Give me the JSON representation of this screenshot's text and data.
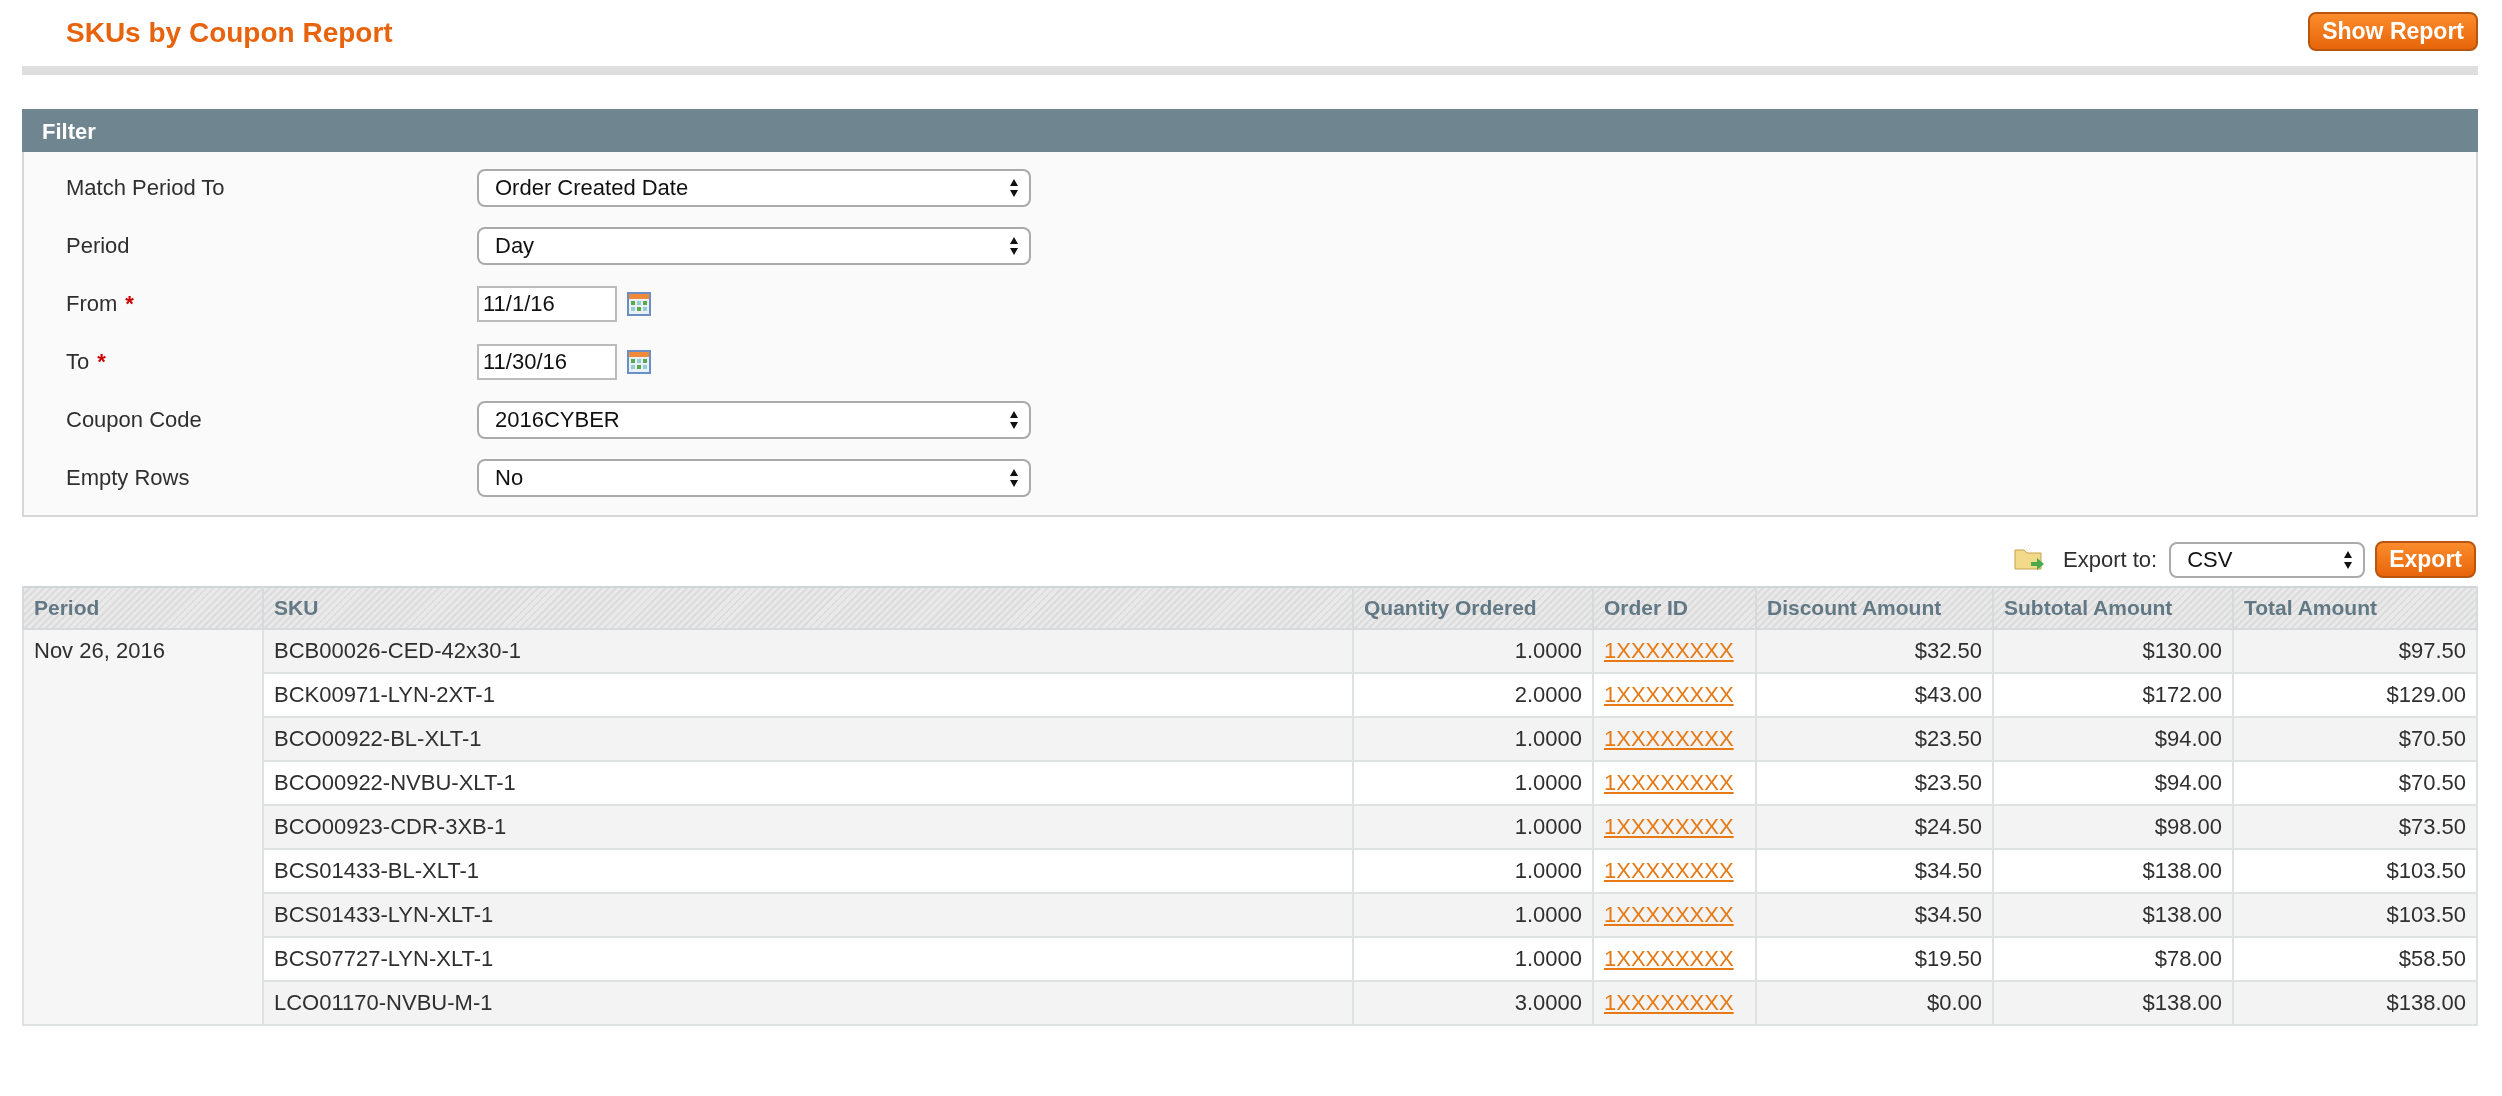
{
  "title": "SKUs by Coupon Report",
  "show_report_button": "Show Report",
  "filter": {
    "title": "Filter",
    "fields": [
      {
        "label": "Match Period To",
        "kind": "select",
        "value": "Order Created Date"
      },
      {
        "label": "Period",
        "kind": "select",
        "value": "Day"
      },
      {
        "label": "From",
        "required_mark": "*",
        "kind": "date",
        "value": "11/1/16"
      },
      {
        "label": "To",
        "required_mark": "*",
        "kind": "date",
        "value": "11/30/16"
      },
      {
        "label": "Coupon Code",
        "kind": "select",
        "value": "2016CYBER"
      },
      {
        "label": "Empty Rows",
        "kind": "select",
        "value": "No"
      }
    ]
  },
  "export": {
    "label": "Export to:",
    "format": "CSV",
    "button": "Export"
  },
  "table": {
    "columns": [
      "Period",
      "SKU",
      "Quantity Ordered",
      "Order ID",
      "Discount Amount",
      "Subtotal Amount",
      "Total Amount"
    ],
    "groups": [
      {
        "period": "Nov 26, 2016",
        "rows": [
          {
            "sku": "BCB00026-CED-42x30-1",
            "quantity": "1.0000",
            "order_id": "1XXXXXXXX",
            "discount": "$32.50",
            "subtotal": "$130.00",
            "total": "$97.50"
          },
          {
            "sku": "BCK00971-LYN-2XT-1",
            "quantity": "2.0000",
            "order_id": "1XXXXXXXX",
            "discount": "$43.00",
            "subtotal": "$172.00",
            "total": "$129.00"
          },
          {
            "sku": "BCO00922-BL-XLT-1",
            "quantity": "1.0000",
            "order_id": "1XXXXXXXX",
            "discount": "$23.50",
            "subtotal": "$94.00",
            "total": "$70.50"
          },
          {
            "sku": "BCO00922-NVBU-XLT-1",
            "quantity": "1.0000",
            "order_id": "1XXXXXXXX",
            "discount": "$23.50",
            "subtotal": "$94.00",
            "total": "$70.50"
          },
          {
            "sku": "BCO00923-CDR-3XB-1",
            "quantity": "1.0000",
            "order_id": "1XXXXXXXX",
            "discount": "$24.50",
            "subtotal": "$98.00",
            "total": "$73.50"
          },
          {
            "sku": "BCS01433-BL-XLT-1",
            "quantity": "1.0000",
            "order_id": "1XXXXXXXX",
            "discount": "$34.50",
            "subtotal": "$138.00",
            "total": "$103.50"
          },
          {
            "sku": "BCS01433-LYN-XLT-1",
            "quantity": "1.0000",
            "order_id": "1XXXXXXXX",
            "discount": "$34.50",
            "subtotal": "$138.00",
            "total": "$103.50"
          },
          {
            "sku": "BCS07727-LYN-XLT-1",
            "quantity": "1.0000",
            "order_id": "1XXXXXXXX",
            "discount": "$19.50",
            "subtotal": "$78.00",
            "total": "$58.50"
          },
          {
            "sku": "LCO01170-NVBU-M-1",
            "quantity": "3.0000",
            "order_id": "1XXXXXXXX",
            "discount": "$0.00",
            "subtotal": "$138.00",
            "total": "$138.00"
          }
        ]
      }
    ]
  }
}
